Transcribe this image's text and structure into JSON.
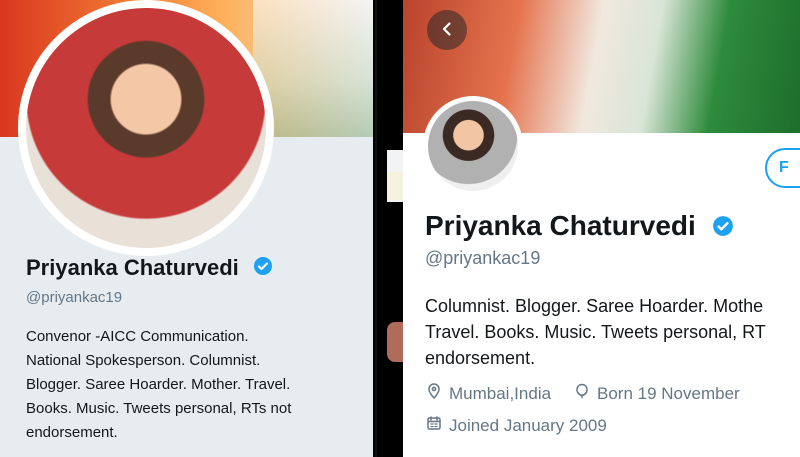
{
  "left_profile": {
    "name": "Priyanka Chaturvedi",
    "handle": "@priyankac19",
    "bio_lines": [
      "Convenor -AICC Communication.",
      "National Spokesperson. Columnist.",
      "Blogger. Saree Hoarder. Mother. Travel.",
      "Books. Music. Tweets personal, RTs not",
      "endorsement."
    ],
    "verified_icon": "verified-badge-icon",
    "accent_color": "#1da1f2"
  },
  "right_profile": {
    "back_icon": "chevron-left-icon",
    "follow_label": "F",
    "name": "Priyanka Chaturvedi",
    "handle": "@priyankac19",
    "bio_lines": [
      "Columnist. Blogger. Saree Hoarder. Mothe",
      "Travel. Books. Music. Tweets personal, RT",
      "endorsement."
    ],
    "location": "Mumbai,India",
    "birthday": "Born 19 November",
    "joined": "Joined January 2009",
    "location_icon": "location-pin-icon",
    "birthday_icon": "balloon-icon",
    "calendar_icon": "calendar-icon",
    "verified_icon": "verified-badge-icon",
    "accent_color": "#1da1f2"
  }
}
